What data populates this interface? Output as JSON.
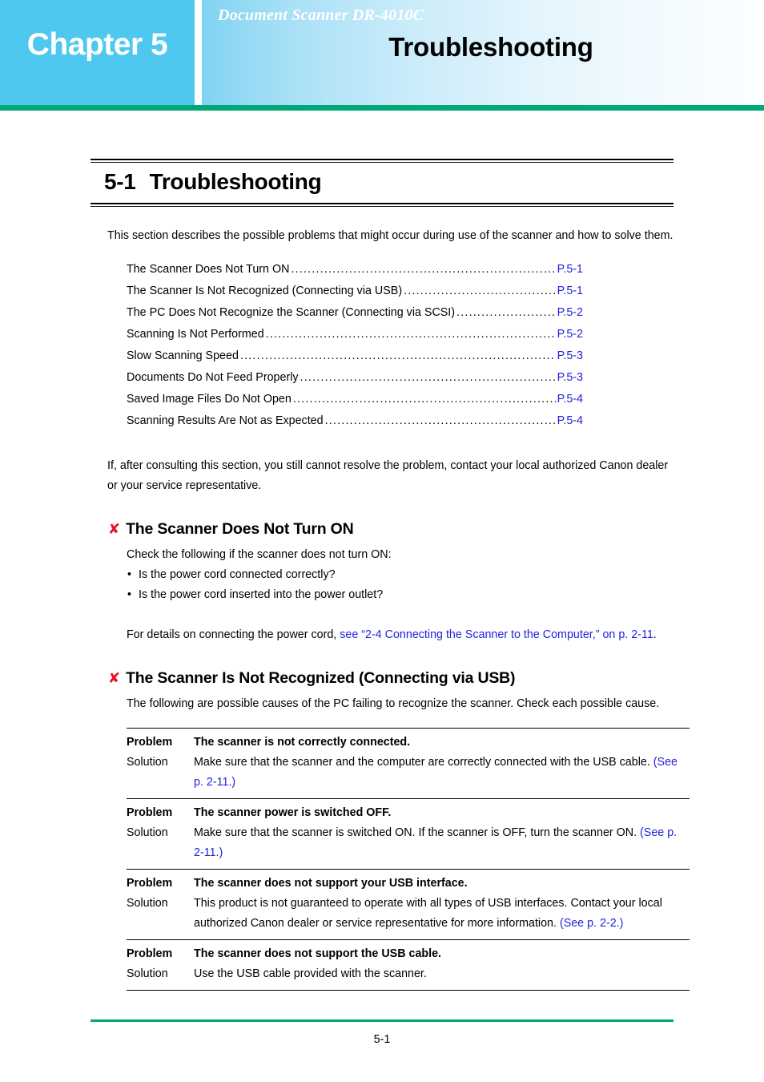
{
  "banner": {
    "chapter_label": "Chapter 5",
    "product_line": "Document Scanner DR-4010C",
    "title": "Troubleshooting",
    "chapter_bg_color": "#4fc8ef",
    "green_bar_color": "#00a878"
  },
  "section": {
    "number": "5-1",
    "title": "Troubleshooting",
    "intro": "This section describes the possible problems that might occur during use of the scanner and how to solve them.",
    "after_toc": "If, after consulting this section, you still cannot resolve the problem, contact your local authorized Canon dealer or your service representative."
  },
  "toc": {
    "dots": "..................................................................................................................................",
    "items": [
      {
        "label": "The Scanner Does Not Turn ON",
        "page": "P.5-1"
      },
      {
        "label": "The Scanner Is Not Recognized (Connecting via USB)",
        "page": "P.5-1"
      },
      {
        "label": "The PC Does Not Recognize the Scanner (Connecting via SCSI)",
        "page": "P.5-2"
      },
      {
        "label": "Scanning Is Not Performed",
        "page": "P.5-2"
      },
      {
        "label": "Slow Scanning Speed",
        "page": "P.5-3"
      },
      {
        "label": "Documents Do Not Feed Properly",
        "page": "P.5-3"
      },
      {
        "label": "Saved Image Files Do Not Open",
        "page": "P.5-4"
      },
      {
        "label": "Scanning Results Are Not as Expected",
        "page": "P.5-4"
      }
    ]
  },
  "topic1": {
    "mark": "✘",
    "heading": "The Scanner Does Not Turn ON",
    "lead": "Check the following if the scanner does not turn ON:",
    "bullets": [
      "Is the power cord connected correctly?",
      "Is the power cord inserted into the power outlet?"
    ],
    "details_prefix": "For details on connecting the power cord, ",
    "details_link": "see “2-4 Connecting the Scanner to the Computer,” on p. 2-11",
    "details_suffix": "."
  },
  "topic2": {
    "mark": "✘",
    "heading": "The Scanner Is Not Recognized (Connecting via USB)",
    "lead": "The following are possible causes of the PC failing to recognize the scanner. Check each possible cause."
  },
  "table": {
    "problem_key": "Problem",
    "solution_key": "Solution",
    "rows": [
      {
        "problem": "The scanner is not correctly connected.",
        "solution_text": "Make sure that the scanner and the computer are correctly connected with the USB cable. ",
        "solution_link": "(See p. 2-11.)"
      },
      {
        "problem": "The scanner power is switched OFF.",
        "solution_text": "Make sure that the scanner is switched ON. If the scanner is OFF, turn the scanner ON. ",
        "solution_link": "(See p. 2-11.)"
      },
      {
        "problem": "The scanner does not support your USB interface.",
        "solution_text": "This product is not guaranteed to operate with all types of USB interfaces. Contact your local authorized Canon dealer or service representative for more information. ",
        "solution_link": "(See p. 2-2.)"
      },
      {
        "problem": "The scanner does not support the USB cable.",
        "solution_text": "Use the USB cable provided with the scanner.",
        "solution_link": ""
      }
    ]
  },
  "footer": {
    "page_number": "5-1",
    "rule_color": "#00a878"
  },
  "colors": {
    "link": "#2222dd",
    "mark_red": "#e8122a"
  }
}
